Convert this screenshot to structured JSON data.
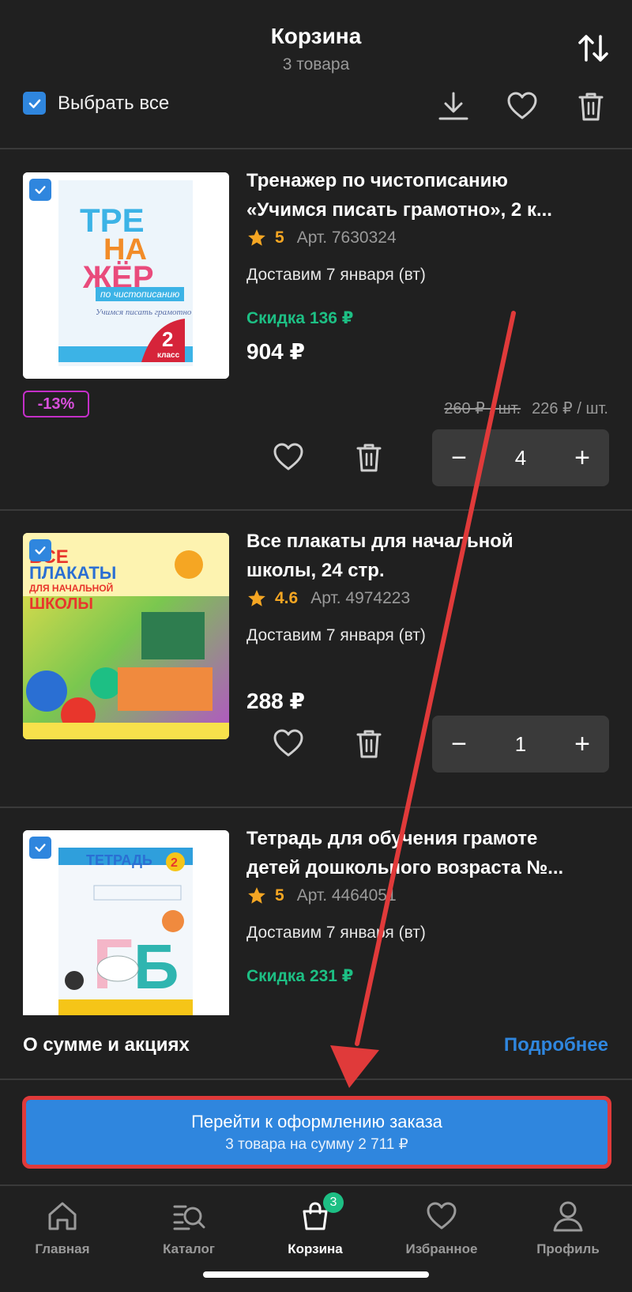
{
  "header": {
    "title": "Корзина",
    "subtitle": "3 товара",
    "select_all_label": "Выбрать все",
    "icons": [
      "sort-icon",
      "download-icon",
      "heart-icon",
      "trash-icon"
    ]
  },
  "items": [
    {
      "title_line1": "Тренажер по чистописанию",
      "title_line2": "«Учимся писать грамотно», 2 к...",
      "rating": "5",
      "art": "Арт. 7630324",
      "delivery": "Доставим 7 января (вт)",
      "discount": "Скидка 136 ₽",
      "price": "904 ₽",
      "badge": "-13%",
      "old_unit_price": "260 ₽ / шт.",
      "unit_price": "226 ₽ / шт.",
      "qty": "4",
      "cover_text": [
        "ТРЕ",
        "НА",
        "ЖЁР",
        "по чистописанию",
        "Учимся писать грамотно",
        "2",
        "класс"
      ]
    },
    {
      "title_line1": "Все плакаты для начальной",
      "title_line2": "школы, 24 стр.",
      "rating": "4.6",
      "art": "Арт. 4974223",
      "delivery": "Доставим 7 января (вт)",
      "price": "288 ₽",
      "qty": "1",
      "cover_text": [
        "ВСЕ",
        "ПЛАКАТЫ",
        "ДЛЯ НАЧАЛЬНОЙ",
        "ШКОЛЫ"
      ]
    },
    {
      "title_line1": "Тетрадь для обучения грамоте",
      "title_line2": "детей дошкольного возраста №...",
      "rating": "5",
      "art": "Арт. 4464051",
      "delivery": "Доставим 7 января (вт)",
      "discount": "Скидка 231 ₽",
      "cover_text": [
        "ТЕТРАДЬ",
        "2",
        "Г",
        "Б"
      ]
    }
  ],
  "summary": {
    "label": "О сумме и акциях",
    "link": "Подробнее"
  },
  "checkout": {
    "label": "Перейти к оформлению заказа",
    "sub": "3 товара на сумму 2 711 ₽"
  },
  "nav": [
    {
      "label": "Главная",
      "icon": "home-icon"
    },
    {
      "label": "Каталог",
      "icon": "catalog-icon"
    },
    {
      "label": "Корзина",
      "icon": "cart-icon",
      "badge": "3",
      "active": true
    },
    {
      "label": "Избранное",
      "icon": "heart-icon"
    },
    {
      "label": "Профиль",
      "icon": "profile-icon"
    }
  ],
  "colors": {
    "background": "#202020",
    "accent": "#2f86de",
    "discount": "#1dbf84",
    "rating": "#f5a623",
    "badge": "#c42fc8",
    "annotation": "#e03a3a"
  }
}
